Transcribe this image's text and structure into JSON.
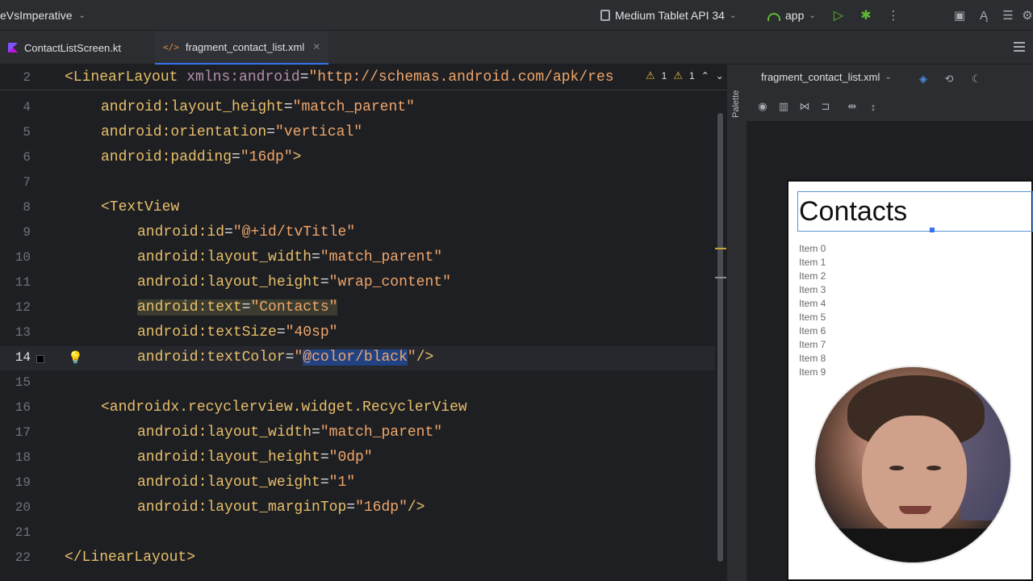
{
  "toolbar": {
    "project": "eVsImperative",
    "device": "Medium Tablet API 34",
    "app": "app"
  },
  "tabs": [
    {
      "label": "ContactListScreen.kt"
    },
    {
      "label": "fragment_contact_list.xml"
    }
  ],
  "editor": {
    "sticky": {
      "line": "2",
      "tag": "<LinearLayout",
      "ns": "xmlns:android",
      "eq": "=",
      "value": "\"http://schemas.android.com/apk/res"
    },
    "warnings": {
      "a": "1",
      "b": "1"
    },
    "lines": [
      {
        "n": "4",
        "attr": "android:layout_height",
        "val": "\"match_parent\""
      },
      {
        "n": "5",
        "attr": "android:orientation",
        "val": "\"vertical\""
      },
      {
        "n": "6",
        "attr": "android:padding",
        "val": "\"16dp\"",
        "tail": ">"
      },
      {
        "n": "7"
      },
      {
        "n": "8",
        "tag": "<TextView"
      },
      {
        "n": "9",
        "attr": "android:id",
        "val": "\"@+id/tvTitle\""
      },
      {
        "n": "10",
        "attr": "android:layout_width",
        "val": "\"match_parent\""
      },
      {
        "n": "11",
        "attr": "android:layout_height",
        "val": "\"wrap_content\""
      },
      {
        "n": "12",
        "attr": "android:text",
        "val": "\"Contacts\""
      },
      {
        "n": "13",
        "attr": "android:textSize",
        "val": "\"40sp\""
      },
      {
        "n": "14",
        "attr": "android:textColor",
        "val_open": "\"",
        "val_sel": "@color/black",
        "val_close": "\"",
        "tail": "/>"
      },
      {
        "n": "15"
      },
      {
        "n": "16",
        "tag": "<androidx.recyclerview.widget.RecyclerView"
      },
      {
        "n": "17",
        "attr": "android:layout_width",
        "val": "\"match_parent\""
      },
      {
        "n": "18",
        "attr": "android:layout_height",
        "val": "\"0dp\""
      },
      {
        "n": "19",
        "attr": "android:layout_weight",
        "val": "\"1\""
      },
      {
        "n": "20",
        "attr": "android:layout_marginTop",
        "val": "\"16dp\"",
        "tail": "/>"
      },
      {
        "n": "21"
      },
      {
        "n": "22",
        "tag": "</LinearLayout",
        "tail": ">"
      }
    ]
  },
  "design": {
    "file": "fragment_contact_list.xml",
    "palette": "Palette",
    "title": "Contacts",
    "items": [
      "Item 0",
      "Item 1",
      "Item 2",
      "Item 3",
      "Item 4",
      "Item 5",
      "Item 6",
      "Item 7",
      "Item 8",
      "Item 9"
    ]
  },
  "colors": {
    "accent": "#3574f0",
    "xml_tag": "#d5b778",
    "xml_value": "#6aab73"
  }
}
